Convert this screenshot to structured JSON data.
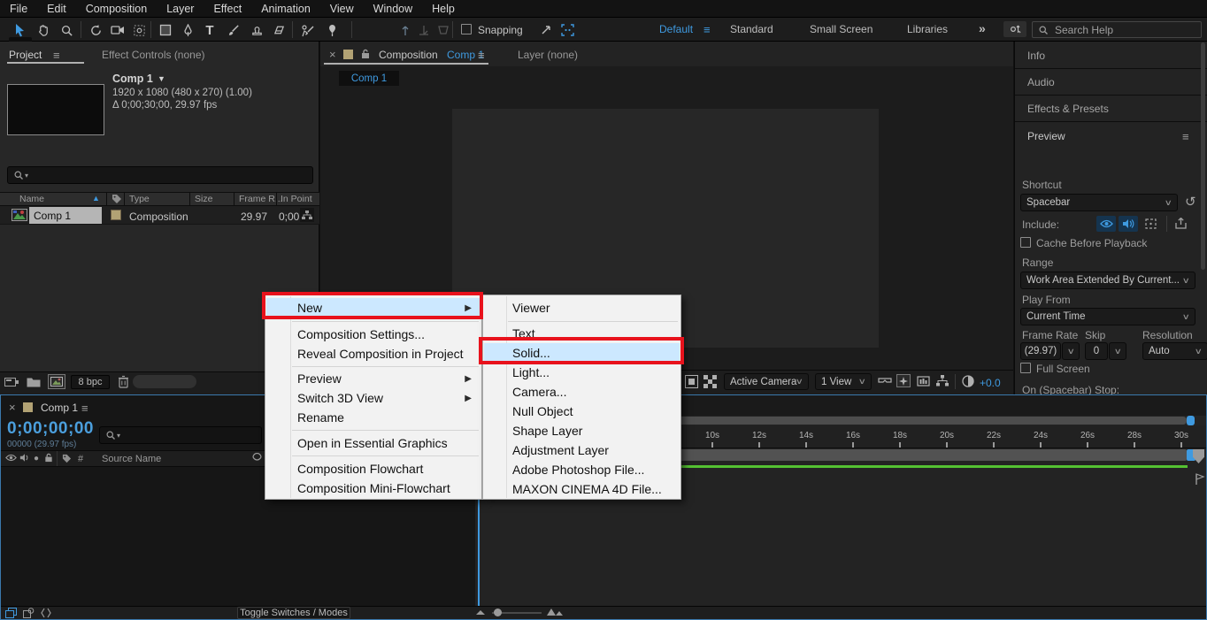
{
  "colors": {
    "accent_blue": "#3f9ae0",
    "annotation_red": "#e8121c",
    "label_tan": "#b2a274",
    "cache_green": "#54c132",
    "menu_highlight": "#cce8ff"
  },
  "menubar": {
    "items": [
      "File",
      "Edit",
      "Composition",
      "Layer",
      "Effect",
      "Animation",
      "View",
      "Window",
      "Help"
    ]
  },
  "toolbar": {
    "snapping_label": "Snapping",
    "workspace_tabs": [
      "Default",
      "Standard",
      "Small Screen",
      "Libraries"
    ],
    "overflow": "»",
    "search_placeholder": "Search Help"
  },
  "project_panel": {
    "tab_project": "Project",
    "tab_effect_controls": "Effect Controls  (none)",
    "comp_name": "Comp 1",
    "comp_dims": "1920 x 1080  (480 x 270) (1.00)",
    "comp_duration": "Δ 0;00;30;00, 29.97 fps",
    "columns": {
      "name": "Name",
      "type": "Type",
      "size": "Size",
      "frame_rate": "Frame R...",
      "in_point": "In Point"
    },
    "row": {
      "name": "Comp 1",
      "type": "Composition",
      "frame_rate": "29.97",
      "in_point": "0;00"
    },
    "bit_depth": "8 bpc"
  },
  "comp_panel": {
    "close": "×",
    "tab_title_prefix": "Composition",
    "tab_title_comp": "Comp 1",
    "tab_layer": "Layer  (none)",
    "viewer_tab": "Comp 1",
    "camera_select": "Active Camera",
    "view_select": "1 View",
    "exposure": "+0.0"
  },
  "sidebar": {
    "panels": [
      "Info",
      "Audio",
      "Effects & Presets"
    ],
    "preview": {
      "title": "Preview",
      "shortcut_label": "Shortcut",
      "shortcut_value": "Spacebar",
      "include_label": "Include:",
      "cache_label": "Cache Before Playback",
      "range_label": "Range",
      "range_value": "Work Area Extended By Current...",
      "play_from_label": "Play From",
      "play_from_value": "Current Time",
      "frame_rate_label": "Frame Rate",
      "frame_rate_value": "(29.97)",
      "skip_label": "Skip",
      "skip_value": "0",
      "resolution_label": "Resolution",
      "resolution_value": "Auto",
      "full_screen_label": "Full Screen",
      "clipped_label": "On (Spacebar) Stop:"
    }
  },
  "timeline": {
    "tab": "Comp 1",
    "close": "×",
    "timecode": "0;00;00;00",
    "frames_info": "00000 (29.97 fps)",
    "col_number": "#",
    "col_source_name": "Source Name",
    "ruler_ticks": [
      "10s",
      "12s",
      "14s",
      "16s",
      "18s",
      "20s",
      "22s",
      "24s",
      "26s",
      "28s",
      "30s"
    ],
    "toggle_button": "Toggle Switches / Modes"
  },
  "context_menu": {
    "items": [
      {
        "label": "New",
        "submenu": true,
        "highlighted": true
      },
      {
        "label": "Composition Settings..."
      },
      {
        "label": "Reveal Composition in Project"
      },
      {
        "label": "Preview",
        "submenu": true
      },
      {
        "label": "Switch 3D View",
        "submenu": true
      },
      {
        "label": "Rename"
      },
      {
        "label": "Open in Essential Graphics"
      },
      {
        "label": "Composition Flowchart"
      },
      {
        "label": "Composition Mini-Flowchart"
      }
    ]
  },
  "new_submenu": {
    "items": [
      "Viewer",
      "Text",
      "Solid...",
      "Light...",
      "Camera...",
      "Null Object",
      "Shape Layer",
      "Adjustment Layer",
      "Adobe Photoshop File...",
      "MAXON CINEMA 4D File..."
    ],
    "highlighted_item": "Solid..."
  }
}
